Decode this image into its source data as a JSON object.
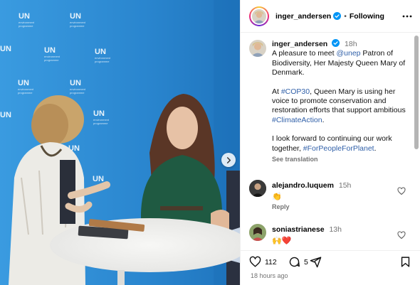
{
  "media": {
    "backdrop_logo_text": "UN",
    "backdrop_logo_sub": "environment programme"
  },
  "header": {
    "username": "inger_andersen",
    "separator": "•",
    "follow_label": "Following"
  },
  "caption": {
    "username": "inger_andersen",
    "time": "18h",
    "p1_text": "A pleasure to meet ",
    "p1_mention": "@unep",
    "p1_rest": " Patron of Biodiversity, Her Majesty Queen Mary of Denmark.",
    "p2_hashtag": "#COP30",
    "p2_rest": ", Queen Mary is using her voice to promote conservation and restoration efforts that support ambitious ",
    "p2_pre": "At ",
    "p2_hashtag2": "#ClimateAction",
    "p2_end": ".",
    "p3_text": "I look forward to continuing our work together, ",
    "p3_hashtag": "#ForPeopleForPlanet",
    "p3_end": ".",
    "see_translation": "See translation"
  },
  "comments": [
    {
      "username": "alejandro.luquem",
      "time": "15h",
      "text": "👏",
      "reply_label": "Reply"
    },
    {
      "username": "soniastrianese",
      "time": "13h",
      "text": "🙌❤️"
    }
  ],
  "actions": {
    "likes": "112",
    "comments": "5",
    "posted": "18 hours ago"
  },
  "colors": {
    "verified": "#0095f6",
    "link": "#2f5fa8",
    "muted": "#737373",
    "backdrop_blue": "#2d8fd6"
  }
}
